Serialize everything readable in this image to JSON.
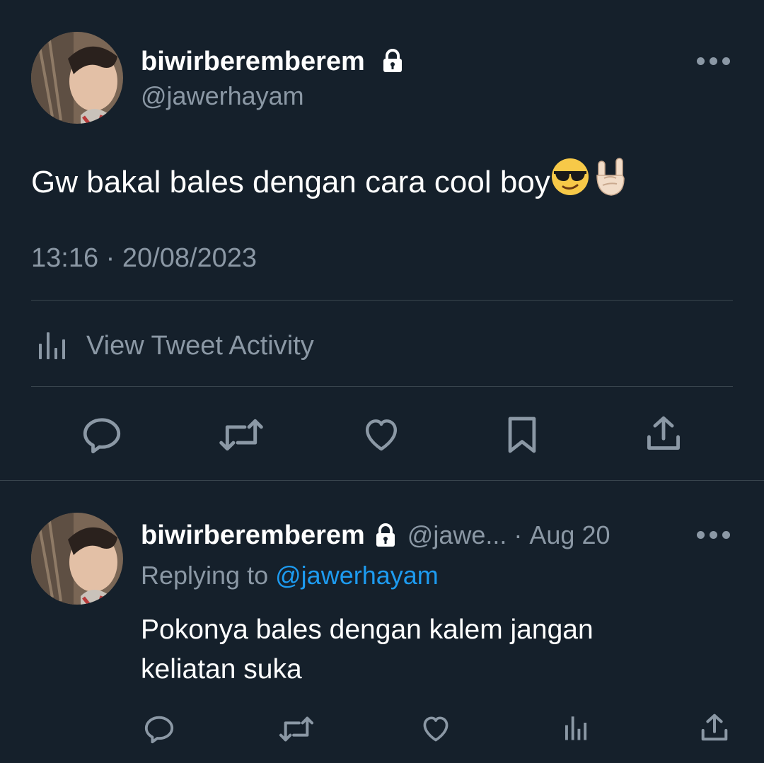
{
  "main_tweet": {
    "display_name": "biwirberemberem",
    "handle": "@jawerhayam",
    "text": "Gw bakal bales dengan cara cool boy",
    "emojis": [
      "smiling-face-with-sunglasses",
      "sign-of-the-horns"
    ],
    "time": "13:16",
    "separator": "·",
    "date": "20/08/2023",
    "activity_label": "View Tweet Activity",
    "actions": [
      "reply",
      "retweet",
      "like",
      "bookmark",
      "share"
    ]
  },
  "reply_tweet": {
    "display_name": "biwirberemberem",
    "handle_truncated": "@jawe...",
    "separator": "·",
    "date": "Aug 20",
    "replying_prefix": "Replying to",
    "replying_handle": "@jawerhayam",
    "text": "Pokonya bales dengan kalem jangan keliatan suka",
    "actions": [
      "reply",
      "retweet",
      "like",
      "views",
      "share"
    ]
  },
  "colors": {
    "background": "#15202b",
    "text_primary": "#ffffff",
    "text_secondary": "#8b98a5",
    "link": "#1d9bf0",
    "divider": "#38444d"
  }
}
